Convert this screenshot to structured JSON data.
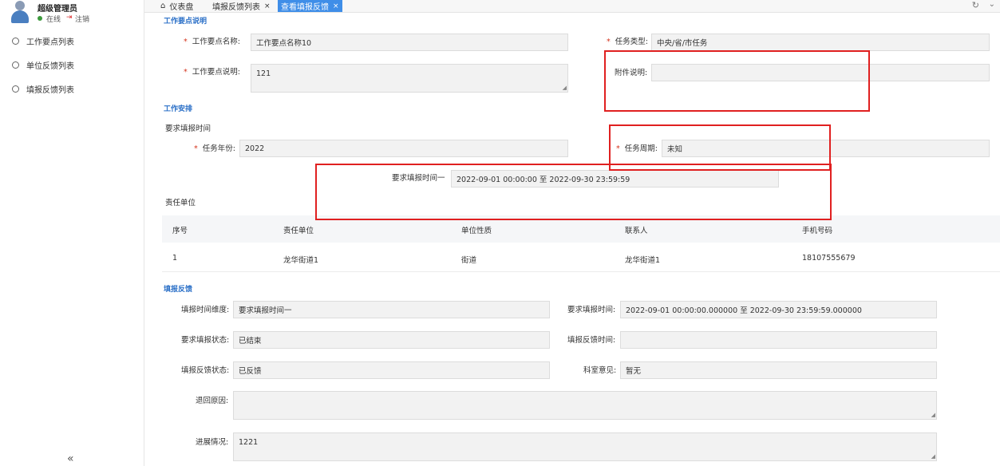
{
  "user": {
    "name": "超级管理员",
    "status": "在线",
    "logout": "注销"
  },
  "sidebar": {
    "items": [
      {
        "label": "工作要点列表"
      },
      {
        "label": "单位反馈列表"
      },
      {
        "label": "填报反馈列表"
      }
    ],
    "collapse": "«"
  },
  "tabs": [
    {
      "label": "仪表盘",
      "icon": "home-icon",
      "closable": false,
      "active": false
    },
    {
      "label": "填报反馈列表",
      "closable": true,
      "active": false
    },
    {
      "label": "查看填报反馈",
      "closable": true,
      "active": true
    }
  ],
  "tab_close": "×",
  "sections": {
    "work_desc": "工作要点说明",
    "arrangement": "工作安排",
    "feedback": "填报反馈"
  },
  "form": {
    "work_name_label": "工作要点名称:",
    "work_name": "工作要点名称10",
    "task_type_label": "任务类型:",
    "task_type": "中央/省/市任务",
    "work_desc_label": "工作要点说明:",
    "work_desc": "121",
    "attach_label": "附件说明:",
    "attach": "",
    "required_time_heading": "要求填报时间",
    "task_year_label": "任务年份:",
    "task_year": "2022",
    "task_cycle_label": "任务周期:",
    "task_cycle": "未知",
    "time1_label": "要求填报时间一",
    "time1": "2022-09-01 00:00:00 至 2022-09-30 23:59:59",
    "resp_heading": "责任单位"
  },
  "table": {
    "columns": [
      "序号",
      "责任单位",
      "单位性质",
      "联系人",
      "手机号码"
    ],
    "rows": [
      [
        "1",
        "龙华街道1",
        "街道",
        "龙华街道1",
        "18107555679"
      ]
    ]
  },
  "feedback": {
    "dimension_label": "填报时间维度:",
    "dimension": "要求填报时间一",
    "req_time_label": "要求填报时间:",
    "req_time": "2022-09-01 00:00:00.000000 至 2022-09-30 23:59:59.000000",
    "req_status_label": "要求填报状态:",
    "req_status": "已结束",
    "fb_time_label": "填报反馈时间:",
    "fb_time": "",
    "fb_status_label": "填报反馈状态:",
    "fb_status": "已反馈",
    "opinion_label": "科室意见:",
    "opinion": "暂无",
    "return_label": "退回原因:",
    "return": "",
    "progress_label": "进展情况:",
    "progress": "1221"
  },
  "colors": {
    "accent": "#3f8ee8",
    "section": "#2a6fc7",
    "required": "#d4331c",
    "annotation": "#e02020",
    "online": "#3c9a3c"
  }
}
